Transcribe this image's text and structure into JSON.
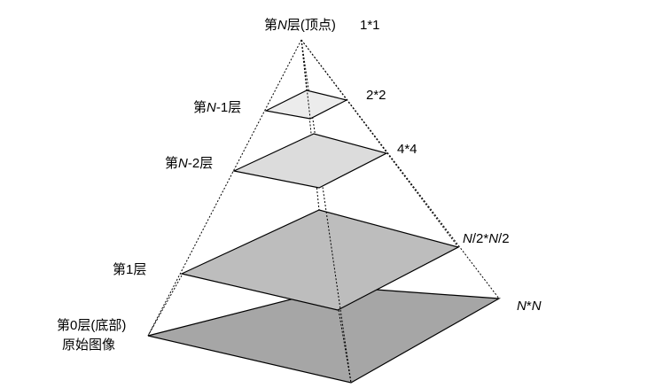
{
  "levels": {
    "top": {
      "prefix": "第",
      "n": "N",
      "suffix": "层(顶点)",
      "size": "1*1"
    },
    "n1": {
      "prefix": "第",
      "n": "N",
      "suffix": "-1层",
      "size": "2*2"
    },
    "n2": {
      "prefix": "第",
      "n": "N",
      "suffix": "-2层",
      "size": "4*4"
    },
    "l1": {
      "label": "第1层",
      "size_n1": "N",
      "size_mid": "/2*",
      "size_n2": "N",
      "size_end": "/2"
    },
    "base": {
      "line1": "第0层(底部)",
      "line2": "原始图像",
      "size_n1": "N",
      "size_mid": "*",
      "size_n2": "N"
    }
  },
  "colors": {
    "base_fill": "#a6a6a6",
    "l1_fill": "#bdbdbd",
    "n2_fill": "#dcdcdc",
    "n1_fill": "#ececec",
    "stroke": "#000000"
  }
}
